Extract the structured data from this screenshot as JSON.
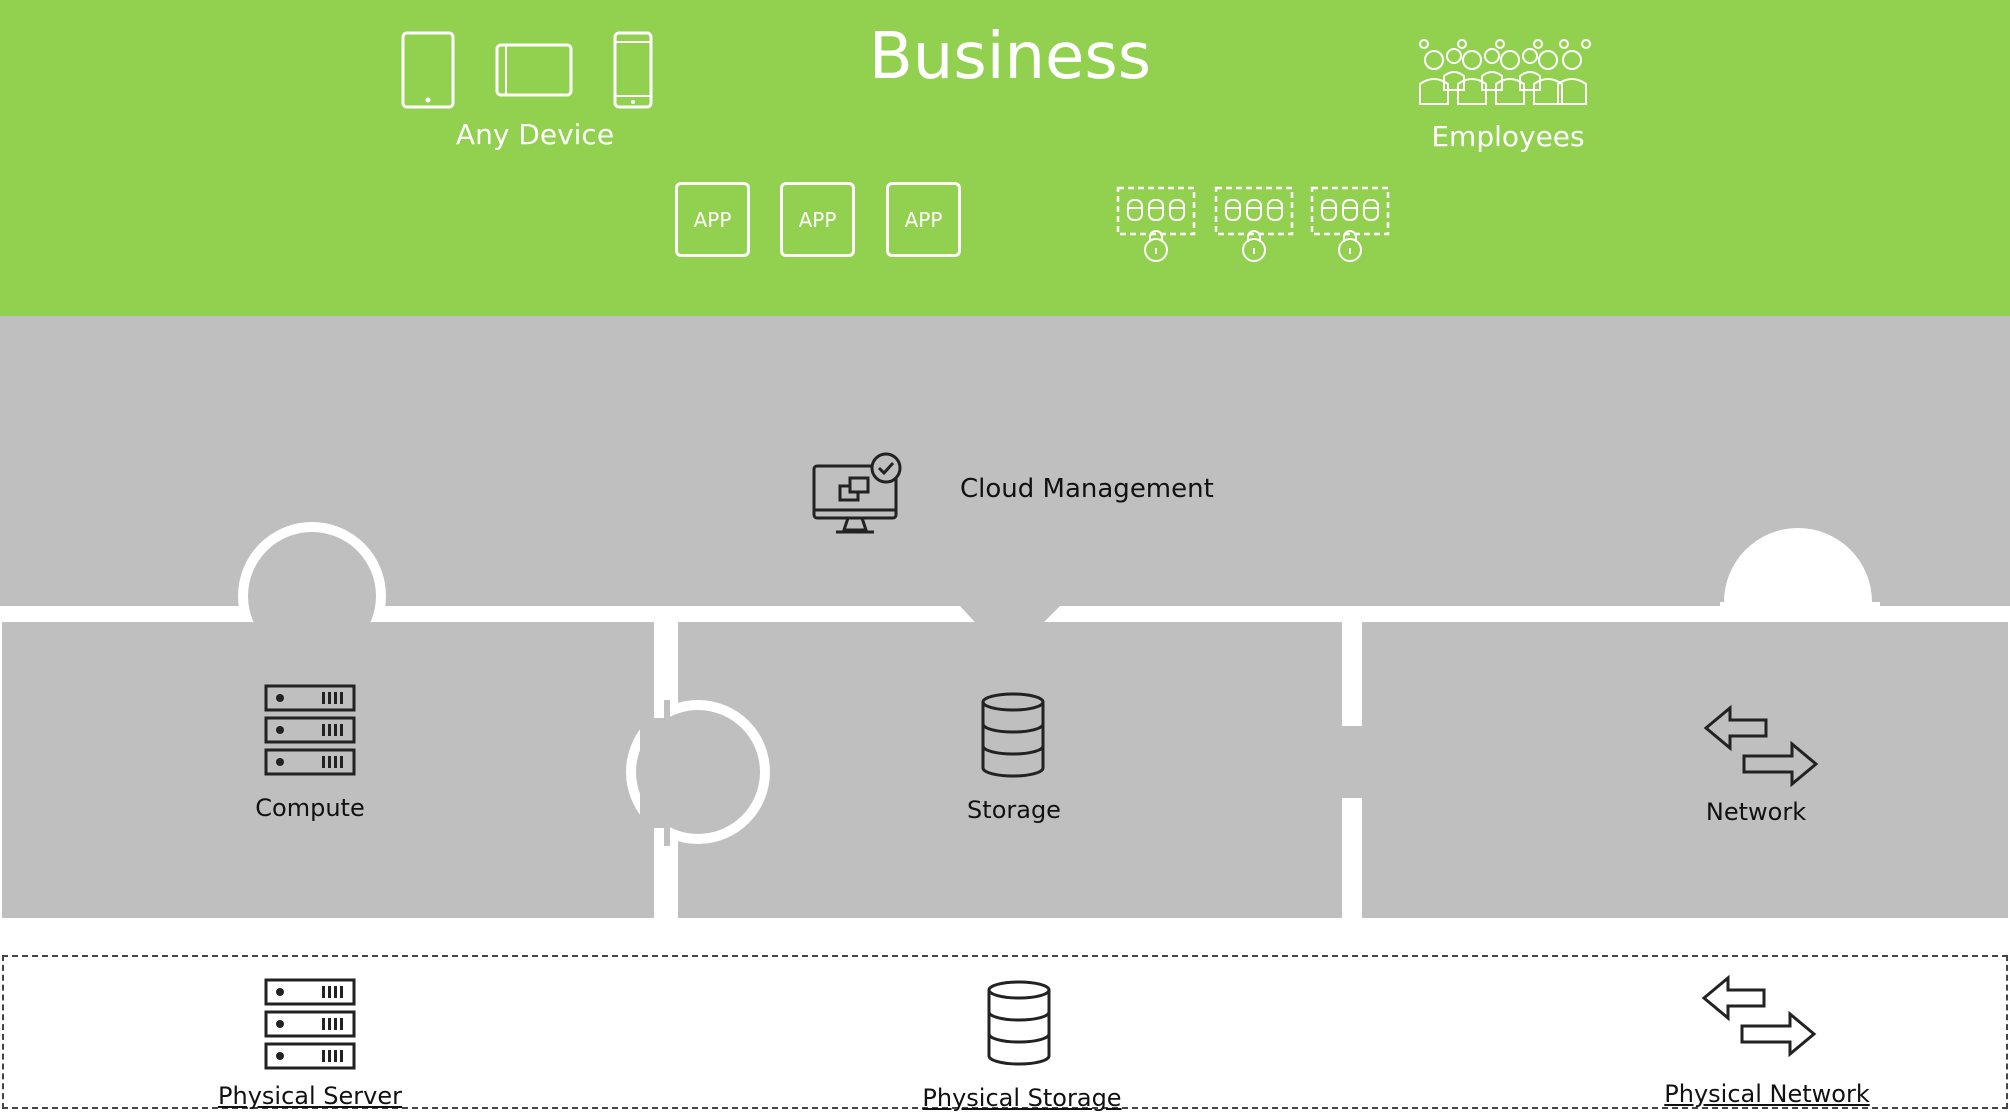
{
  "business": {
    "title": "Business",
    "devices_label": "Any Device",
    "employees_label": "Employees",
    "apps": [
      "APP",
      "APP",
      "APP"
    ]
  },
  "cloud_management": {
    "label": "Cloud Management"
  },
  "virtual": {
    "compute": "Compute",
    "storage": "Storage",
    "network": "Network"
  },
  "physical": {
    "server": "Physical Server",
    "storage": "Physical Storage",
    "network": "Physical Network"
  },
  "colors": {
    "business_green": "#92d050",
    "layer_grey": "#bfbfbf",
    "icon_stroke": "#222222"
  },
  "icons": {
    "devices": [
      "tablet-icon",
      "tablet-landscape-icon",
      "phone-icon"
    ],
    "employees": "employees-group-icon",
    "databases": [
      "secure-database-icon",
      "secure-database-icon",
      "secure-database-icon"
    ],
    "cloud_management": "monitor-check-icon",
    "compute": "server-rack-icon",
    "storage": "database-icon",
    "network": "network-arrows-icon"
  }
}
